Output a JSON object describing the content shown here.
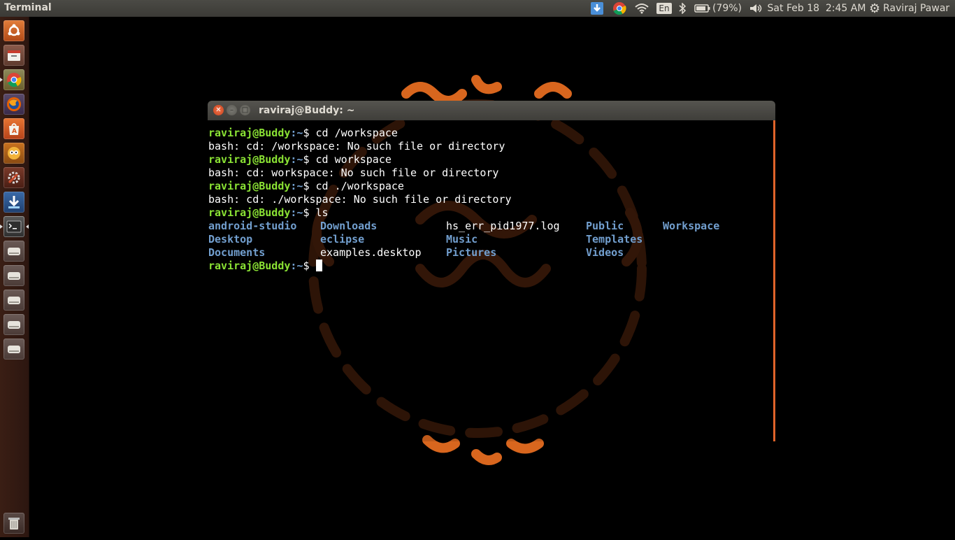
{
  "top_panel": {
    "app_title": "Terminal",
    "battery": "(79%)",
    "language": "En",
    "clock": "Sat Feb 18  2:45 AM",
    "user": "Raviraj Pawar"
  },
  "launcher": {
    "items": [
      "ubuntu-dash-icon",
      "file-manager-icon",
      "chrome-icon",
      "firefox-icon",
      "software-center-icon",
      "app-icon",
      "settings-icon",
      "update-icon",
      "terminal-icon",
      "drive-icon",
      "drive-icon",
      "drive-icon",
      "drive-icon",
      "drive-icon"
    ],
    "trash": "trash-icon"
  },
  "terminal": {
    "window_title": "raviraj@Buddy: ~",
    "prompt_user": "raviraj@Buddy",
    "prompt_path": ":~",
    "prompt_symbol": "$",
    "lines": [
      {
        "type": "prompt",
        "cmd": " cd /workspace"
      },
      {
        "type": "out",
        "text": "bash: cd: /workspace: No such file or directory"
      },
      {
        "type": "prompt",
        "cmd": " cd workspace"
      },
      {
        "type": "out",
        "text": "bash: cd: workspace: No such file or directory"
      },
      {
        "type": "prompt",
        "cmd": " cd ./workspace"
      },
      {
        "type": "out",
        "text": "bash: cd: ./workspace: No such file or directory"
      },
      {
        "type": "prompt",
        "cmd": " ls"
      }
    ],
    "ls_rows": [
      [
        {
          "text": "android-studio",
          "dir": true
        },
        {
          "text": "Downloads",
          "dir": true
        },
        {
          "text": "hs_err_pid1977.log",
          "dir": false
        },
        {
          "text": "Public",
          "dir": true
        },
        {
          "text": "Workspace",
          "dir": true
        }
      ],
      [
        {
          "text": "Desktop",
          "dir": true
        },
        {
          "text": "eclipse",
          "dir": true
        },
        {
          "text": "Music",
          "dir": true
        },
        {
          "text": "Templates",
          "dir": true
        },
        {
          "text": "",
          "dir": false
        }
      ],
      [
        {
          "text": "Documents",
          "dir": true
        },
        {
          "text": "examples.desktop",
          "dir": false
        },
        {
          "text": "Pictures",
          "dir": true
        },
        {
          "text": "Videos",
          "dir": true
        },
        {
          "text": "",
          "dir": false
        }
      ]
    ]
  },
  "colors": {
    "prompt": "#8ae234",
    "dir": "#729fcf",
    "accent": "#e0632a"
  }
}
